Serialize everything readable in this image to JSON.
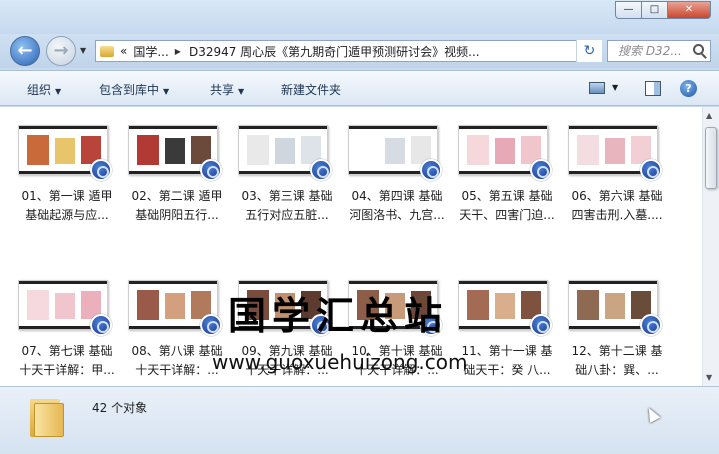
{
  "window": {
    "controls": {
      "minimize": "—",
      "maximize": "□",
      "close": "✕"
    }
  },
  "nav": {
    "back_icon": "arrow-left-icon",
    "forward_icon": "arrow-right-icon",
    "address": {
      "overflow": "«",
      "segments": [
        "国学...",
        "D32947  周心辰《第九期奇门遁甲预测研讨会》视频..."
      ]
    },
    "search_placeholder": "搜索 D32..."
  },
  "toolbar": {
    "organize": "组织",
    "include_library": "包含到库中",
    "share": "共享",
    "new_folder": "新建文件夹"
  },
  "files": [
    {
      "line1": "01、第一课 遁甲",
      "line2": "基础起源与应...",
      "thumb": [
        "#c96a3a",
        "#e8c46a",
        "#b9453a"
      ]
    },
    {
      "line1": "02、第二课 遁甲",
      "line2": "基础阴阳五行...",
      "thumb": [
        "#b23a35",
        "#3a3a3a",
        "#6b4a3b"
      ]
    },
    {
      "line1": "03、第三课 基础",
      "line2": "五行对应五脏...",
      "thumb": [
        "#e9e9e9",
        "#cfd6de",
        "#dde3e8"
      ]
    },
    {
      "line1": "04、第四课 基础",
      "line2": "河图洛书、九宫...",
      "thumb": [
        "#ffffff",
        "#d7dbe4",
        "#e7e7e7"
      ]
    },
    {
      "line1": "05、第五课 基础",
      "line2": "天干、四害门迫...",
      "thumb": [
        "#f6d7dc",
        "#e7a9b5",
        "#f1c5cc"
      ]
    },
    {
      "line1": "06、第六课 基础",
      "line2": "四害击刑.入墓....",
      "thumb": [
        "#f4dde1",
        "#e8b5bf",
        "#f2cfd5"
      ]
    },
    {
      "line1": "07、第七课 基础",
      "line2": "十天干详解：甲...",
      "thumb": [
        "#f6d9de",
        "#f0c5cd",
        "#ebb0bc"
      ]
    },
    {
      "line1": "08、第八课 基础",
      "line2": "十天干详解：...",
      "thumb": [
        "#9a5a4a",
        "#d3a07f",
        "#b27a5c"
      ]
    },
    {
      "line1": "09、第九课 基础",
      "line2": "十天干详解：...",
      "thumb": [
        "#7a4c3e",
        "#c2906d",
        "#5d3b2e"
      ]
    },
    {
      "line1": "10、第十课 基础",
      "line2": "十天干详解：...",
      "thumb": [
        "#8c5d49",
        "#c79a7a",
        "#6d4838"
      ]
    },
    {
      "line1": "11、第十一课 基",
      "line2": "础天干：癸  八...",
      "thumb": [
        "#a46b54",
        "#d9ae8c",
        "#7f513f"
      ]
    },
    {
      "line1": "12、第十二课 基",
      "line2": "础八卦：巽、...",
      "thumb": [
        "#8e6a52",
        "#caa583",
        "#6a4c3a"
      ]
    }
  ],
  "watermark": {
    "title": "国学汇总站",
    "url": "www.guoxuehuizong.com"
  },
  "status": {
    "count": "42 个对象"
  },
  "colors": {
    "chrome": "#c9dcef",
    "play_badge": "#1f49a8"
  }
}
